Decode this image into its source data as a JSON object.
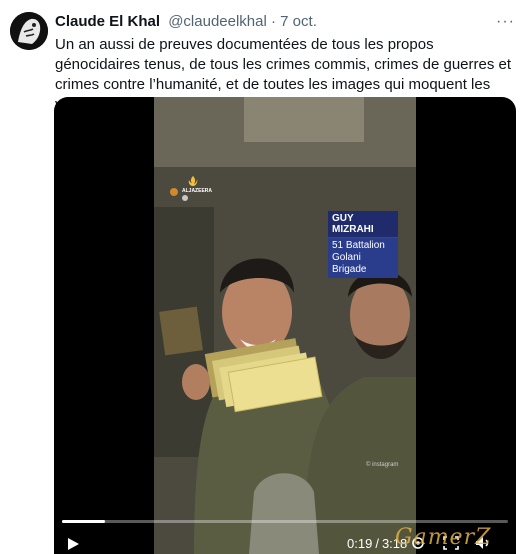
{
  "tweet": {
    "author_name": "Claude El Khal",
    "handle": "@claudeelkhal",
    "separator": "·",
    "date": "7 oct.",
    "more_label": "···",
    "text": "Un an aussi de preuves documentées de tous les propos génocidaires tenus, de tous les crimes commis, crimes de guerres et crimes contre l’humanité, et de toutes les images qui moquent les victimes de ces crimes."
  },
  "video": {
    "watermark": "ALJAZEERA",
    "caption_name": "GUY MIZRAHI",
    "caption_unit": "51 Battalion Golani Brigade",
    "credit": "© instagram",
    "current_time": "0:19",
    "time_separator": "/",
    "duration": "3:18",
    "progress_fraction": 0.096
  },
  "site_watermark": "GamerZ",
  "icons": [
    "play-icon",
    "settings-icon",
    "fullscreen-icon",
    "volume-icon",
    "more-icon"
  ]
}
